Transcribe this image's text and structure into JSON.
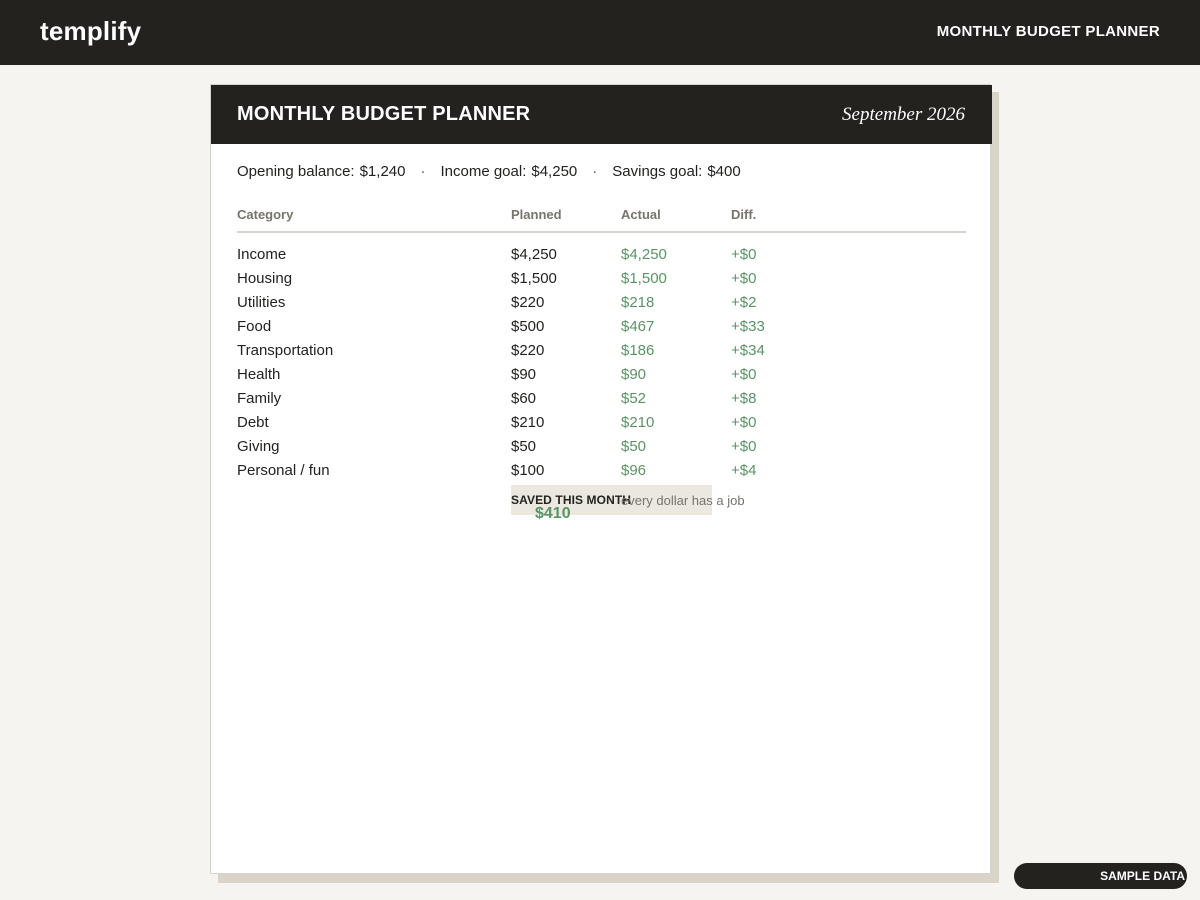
{
  "app": {
    "brand": "templify",
    "header_title": "MONTHLY BUDGET PLANNER"
  },
  "sheet": {
    "title": "MONTHLY BUDGET PLANNER",
    "month": "September 2026",
    "summary": {
      "opening_balance_label": "Opening balance:",
      "opening_balance_value": "$1,240",
      "separator": "·",
      "income_goal_label": "Income goal:",
      "income_goal_value": "$4,250",
      "savings_goal_label": "Savings goal:",
      "savings_goal_value": "$400"
    },
    "table": {
      "columns": [
        "Category",
        "Planned",
        "Actual",
        "Diff."
      ],
      "rows": [
        {
          "category": "Income",
          "planned": "$4,250",
          "actual": "$4,250",
          "diff": "+$0"
        },
        {
          "category": "Housing",
          "planned": "$1,500",
          "actual": "$1,500",
          "diff": "+$0"
        },
        {
          "category": "Utilities",
          "planned": "$220",
          "actual": "$218",
          "diff": "+$2"
        },
        {
          "category": "Food",
          "planned": "$500",
          "actual": "$467",
          "diff": "+$33"
        },
        {
          "category": "Transportation",
          "planned": "$220",
          "actual": "$186",
          "diff": "+$34"
        },
        {
          "category": "Health",
          "planned": "$90",
          "actual": "$90",
          "diff": "+$0"
        },
        {
          "category": "Family",
          "planned": "$60",
          "actual": "$52",
          "diff": "+$8"
        },
        {
          "category": "Debt",
          "planned": "$210",
          "actual": "$210",
          "diff": "+$0"
        },
        {
          "category": "Giving",
          "planned": "$50",
          "actual": "$50",
          "diff": "+$0"
        },
        {
          "category": "Personal / fun",
          "planned": "$100",
          "actual": "$96",
          "diff": "+$4"
        }
      ]
    },
    "saved": {
      "label": "SAVED THIS MONTH",
      "value": "$410",
      "note": "every dollar has a job"
    }
  },
  "badge": {
    "label": "SAMPLE DATA"
  },
  "colors": {
    "dark": "#23221f",
    "positive": "#5a9366",
    "page_background": "#f5f4f0",
    "muted": "#77746c"
  }
}
